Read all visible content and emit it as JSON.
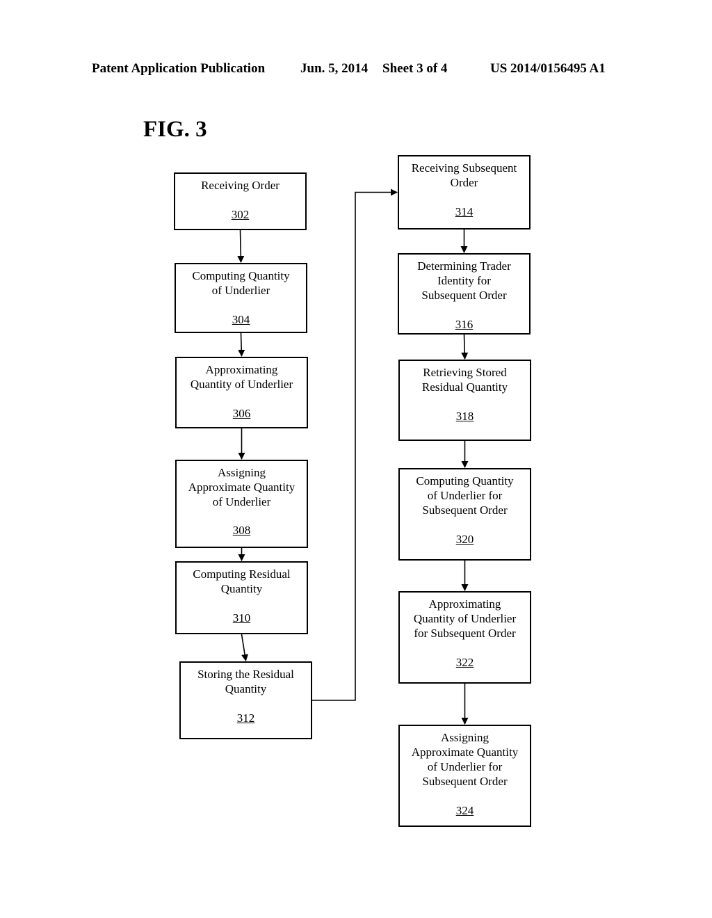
{
  "header": {
    "left": "Patent Application Publication",
    "date": "Jun. 5, 2014",
    "sheet": "Sheet 3 of 4",
    "pub_number": "US 2014/0156495 A1"
  },
  "figure": {
    "title": "FIG. 3",
    "steps": [
      {
        "ref": "302",
        "label": "Receiving Order"
      },
      {
        "ref": "304",
        "label": "Computing Quantity\nof Underlier"
      },
      {
        "ref": "306",
        "label": "Approximating\nQuantity of Underlier"
      },
      {
        "ref": "308",
        "label": "Assigning\nApproximate Quantity\nof Underlier"
      },
      {
        "ref": "310",
        "label": "Computing Residual\nQuantity"
      },
      {
        "ref": "312",
        "label": "Storing the Residual\nQuantity"
      },
      {
        "ref": "314",
        "label": "Receiving Subsequent\nOrder"
      },
      {
        "ref": "316",
        "label": "Determining Trader\nIdentity for\nSubsequent Order"
      },
      {
        "ref": "318",
        "label": "Retrieving Stored\nResidual Quantity"
      },
      {
        "ref": "320",
        "label": "Computing Quantity\nof Underlier for\nSubsequent Order"
      },
      {
        "ref": "322",
        "label": "Approximating\nQuantity of Underlier\nfor Subsequent Order"
      },
      {
        "ref": "324",
        "label": "Assigning\nApproximate Quantity\nof Underlier for\nSubsequent Order"
      }
    ],
    "flow": [
      [
        "302",
        "304"
      ],
      [
        "304",
        "306"
      ],
      [
        "306",
        "308"
      ],
      [
        "308",
        "310"
      ],
      [
        "310",
        "312"
      ],
      [
        "312",
        "314"
      ],
      [
        "314",
        "316"
      ],
      [
        "316",
        "318"
      ],
      [
        "318",
        "320"
      ],
      [
        "320",
        "322"
      ],
      [
        "322",
        "324"
      ]
    ]
  }
}
